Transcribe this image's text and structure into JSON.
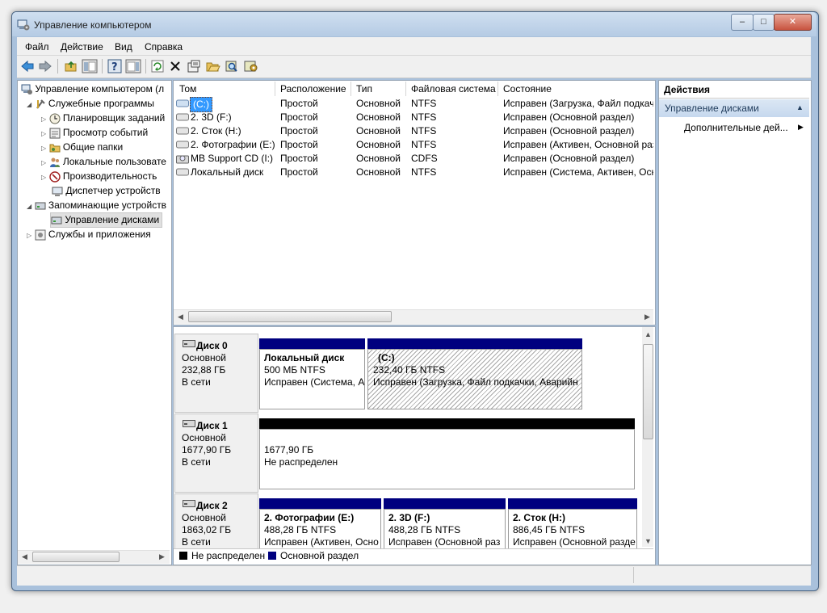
{
  "window": {
    "title": "Управление компьютером"
  },
  "caption_buttons": {
    "minimize": "–",
    "maximize": "□",
    "close": "✕"
  },
  "menu": [
    "Файл",
    "Действие",
    "Вид",
    "Справка"
  ],
  "toolbar_icons": [
    "back-arrow",
    "forward-arrow",
    "up-folder",
    "show-hide-tree",
    "help",
    "show-hide-action-pane",
    "refresh",
    "delete",
    "properties",
    "open",
    "magnify",
    "settings"
  ],
  "tree": {
    "root": "Управление компьютером (л",
    "utilities": "Служебные программы",
    "utilities_children": [
      "Планировщик заданий",
      "Просмотр событий",
      "Общие папки",
      "Локальные пользовате",
      "Производительность",
      "Диспетчер устройств"
    ],
    "storage": "Запоминающие устройств",
    "storage_children": [
      "Управление дисками"
    ],
    "services": "Службы и приложения"
  },
  "volume_table": {
    "columns": [
      "Том",
      "Расположение",
      "Тип",
      "Файловая система",
      "Состояние"
    ],
    "rows": [
      [
        "(C:)",
        "Простой",
        "Основной",
        "NTFS",
        "Исправен (Загрузка, Файл подкач"
      ],
      [
        "2. 3D (F:)",
        "Простой",
        "Основной",
        "NTFS",
        "Исправен (Основной раздел)"
      ],
      [
        "2. Сток (H:)",
        "Простой",
        "Основной",
        "NTFS",
        "Исправен (Основной раздел)"
      ],
      [
        "2. Фотографии (E:)",
        "Простой",
        "Основной",
        "NTFS",
        "Исправен (Активен, Основной раз"
      ],
      [
        "MB Support CD (I:)",
        "Простой",
        "Основной",
        "CDFS",
        "Исправен (Основной раздел)"
      ],
      [
        "Локальный диск",
        "Простой",
        "Основной",
        "NTFS",
        "Исправен (Система, Активен, Осн"
      ]
    ]
  },
  "disks": [
    {
      "name": "Диск 0",
      "type": "Основной",
      "size": "232,88 ГБ",
      "status": "В сети",
      "partitions": [
        {
          "title": "Локальный диск",
          "size": "500 МБ NTFS",
          "status": "Исправен (Система, А"
        },
        {
          "title": "(C:)",
          "size": "232,40 ГБ NTFS",
          "status": "Исправен (Загрузка, Файл подкачки, Аварийн"
        }
      ]
    },
    {
      "name": "Диск 1",
      "type": "Основной",
      "size": "1677,90 ГБ",
      "status": "В сети",
      "partitions": [
        {
          "title": "",
          "size": "1677,90 ГБ",
          "status": "Не распределен"
        }
      ]
    },
    {
      "name": "Диск 2",
      "type": "Основной",
      "size": "1863,02 ГБ",
      "status": "В сети",
      "partitions": [
        {
          "title": "2. Фотографии  (E:)",
          "size": "488,28 ГБ NTFS",
          "status": "Исправен (Активен, Осно"
        },
        {
          "title": "2. 3D  (F:)",
          "size": "488,28 ГБ NTFS",
          "status": "Исправен (Основной раз"
        },
        {
          "title": "2. Сток  (H:)",
          "size": "886,45 ГБ NTFS",
          "status": "Исправен (Основной разде"
        }
      ]
    }
  ],
  "legend": [
    {
      "label": "Не распределен",
      "color": "#000000"
    },
    {
      "label": "Основной раздел",
      "color": "#00007f"
    }
  ],
  "actions": {
    "header": "Действия",
    "section": "Управление дисками",
    "more": "Дополнительные дей..."
  },
  "colors": {
    "partition_bar": "#00007f",
    "unallocated_bar": "#000000",
    "selection": "#3399ff"
  }
}
